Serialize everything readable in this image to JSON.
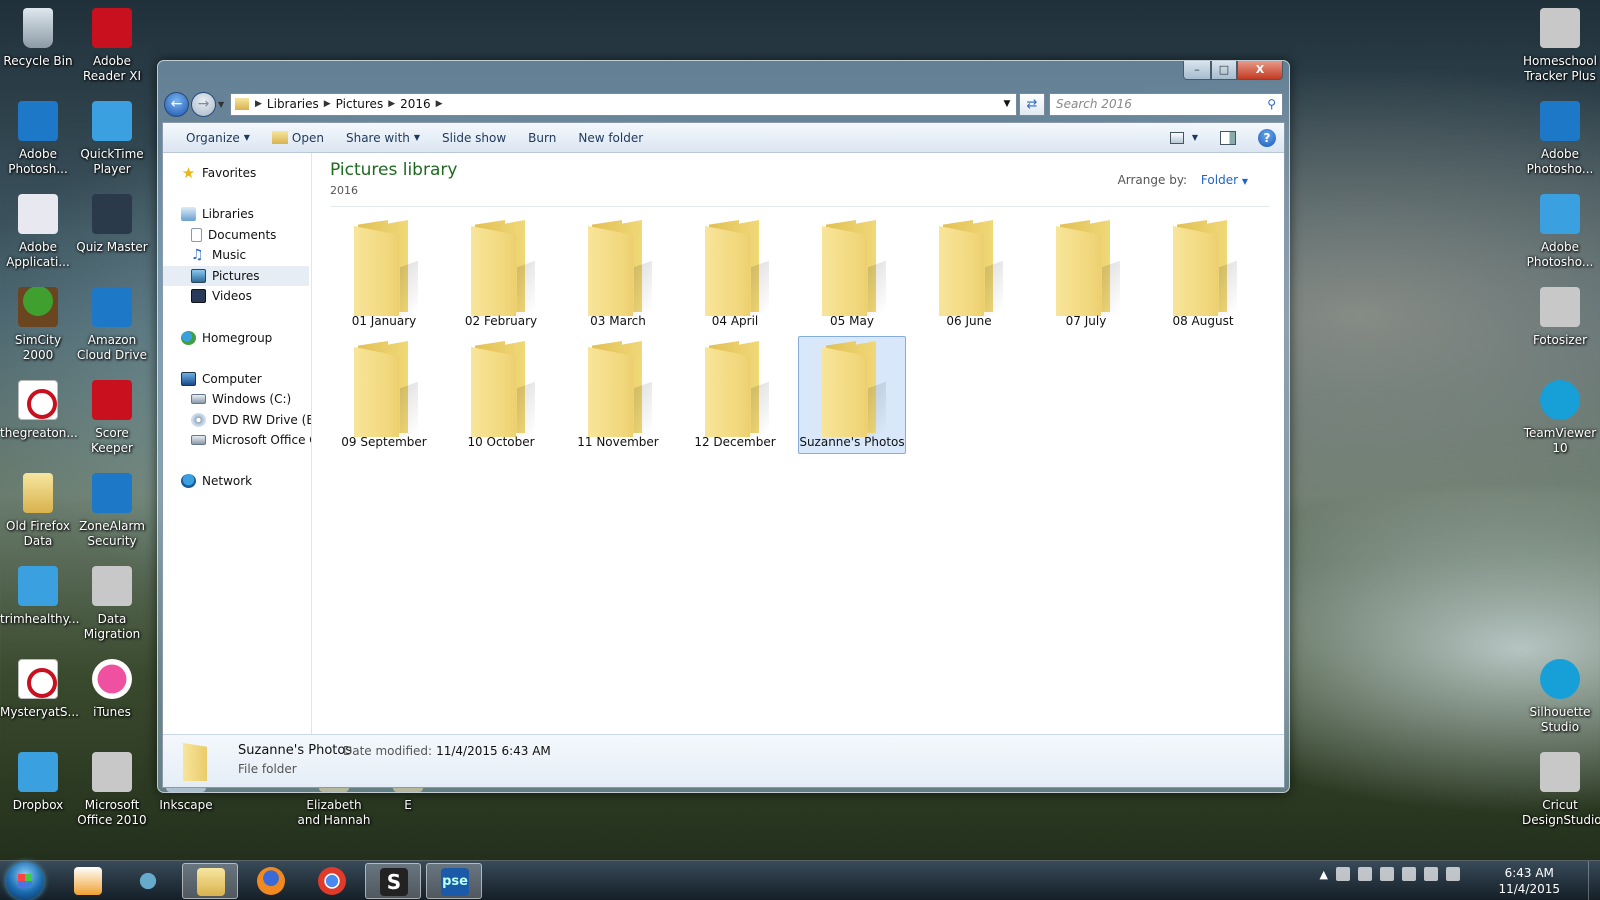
{
  "desktop": {
    "left_icons": [
      {
        "label": "Recycle Bin",
        "icon": "recycle-bin-icon"
      },
      {
        "label": "Adobe Reader XI",
        "icon": "adobe-reader-icon"
      },
      {
        "label": "Adobe Photosh...",
        "icon": "photoshop-icon"
      },
      {
        "label": "QuickTime Player",
        "icon": "quicktime-icon"
      },
      {
        "label": "Adobe Applicati...",
        "icon": "adobe-app-manager-icon"
      },
      {
        "label": "Quiz Master",
        "icon": "quiz-master-icon"
      },
      {
        "label": "SimCity 2000",
        "icon": "simcity-icon"
      },
      {
        "label": "Amazon Cloud Drive",
        "icon": "amazon-cloud-icon"
      },
      {
        "label": "thegreaton...",
        "icon": "pdf-icon"
      },
      {
        "label": "Score Keeper",
        "icon": "score-keeper-icon"
      },
      {
        "label": "Old Firefox Data",
        "icon": "folder-icon"
      },
      {
        "label": "ZoneAlarm Security",
        "icon": "zonealarm-icon"
      },
      {
        "label": "trimhealthy...",
        "icon": "book-icon"
      },
      {
        "label": "Data Migration",
        "icon": "data-migration-icon"
      },
      {
        "label": "MysteryatS...",
        "icon": "pdf-icon"
      },
      {
        "label": "iTunes",
        "icon": "itunes-icon"
      },
      {
        "label": "Dropbox",
        "icon": "dropbox-icon"
      },
      {
        "label": "Microsoft Office 2010",
        "icon": "office-icon"
      },
      {
        "label": "Inkscape",
        "icon": "inkscape-icon"
      },
      {
        "label": "Elizabeth and Hannah",
        "icon": "file-icon"
      },
      {
        "label": "E",
        "icon": "file-icon"
      }
    ],
    "right_icons": [
      {
        "label": "Homeschool Tracker Plus",
        "icon": "hst-icon"
      },
      {
        "label": "Adobe Photosho...",
        "icon": "photoshop-elements-icon"
      },
      {
        "label": "Adobe Photosho...",
        "icon": "photoshop-elements-organizer-icon"
      },
      {
        "label": "Fotosizer",
        "icon": "camera-icon"
      },
      {
        "label": "TeamViewer 10",
        "icon": "teamviewer-icon"
      },
      {
        "label": "Silhouette Studio",
        "icon": "silhouette-icon"
      },
      {
        "label": "Cricut DesignStudio",
        "icon": "cricut-icon"
      }
    ]
  },
  "window": {
    "caption": {
      "minimize": "–",
      "maximize": "□",
      "close": "X"
    },
    "address": {
      "crumbs": [
        "Libraries",
        "Pictures",
        "2016"
      ],
      "separator": "▶"
    },
    "search": {
      "placeholder": "Search 2016"
    },
    "toolbar": {
      "organize": "Organize",
      "open": "Open",
      "share_with": "Share with",
      "slide_show": "Slide show",
      "burn": "Burn",
      "new_folder": "New folder",
      "help": "?"
    },
    "nav": {
      "favorites": "Favorites",
      "libraries": "Libraries",
      "documents": "Documents",
      "music": "Music",
      "pictures": "Pictures",
      "videos": "Videos",
      "homegroup": "Homegroup",
      "computer": "Computer",
      "windows_c": "Windows (C:)",
      "dvd_drive": "DVD RW Drive (E:) I",
      "ms_office": "Microsoft Office Cl",
      "network": "Network"
    },
    "content": {
      "title": "Pictures library",
      "subtitle": "2016",
      "arrange_label": "Arrange by:",
      "arrange_value": "Folder",
      "folders": [
        "01 January",
        "02 February",
        "03 March",
        "04 April",
        "05 May",
        "06 June",
        "07 July",
        "08 August",
        "09 September",
        "10 October",
        "11 November",
        "12 December",
        "Suzanne's Photos"
      ]
    },
    "details": {
      "name": "Suzanne's Photos",
      "modified_label": "Date modified:",
      "modified_value": "11/4/2015 6:43 AM",
      "type": "File folder"
    }
  },
  "taskbar": {
    "time": "6:43 AM",
    "date": "11/4/2015",
    "pinned": [
      "media-player-icon",
      "people-icon",
      "explorer-icon",
      "firefox-icon",
      "chrome-icon",
      "silhouette-icon",
      "pse-icon"
    ],
    "pse_label": "pse"
  }
}
